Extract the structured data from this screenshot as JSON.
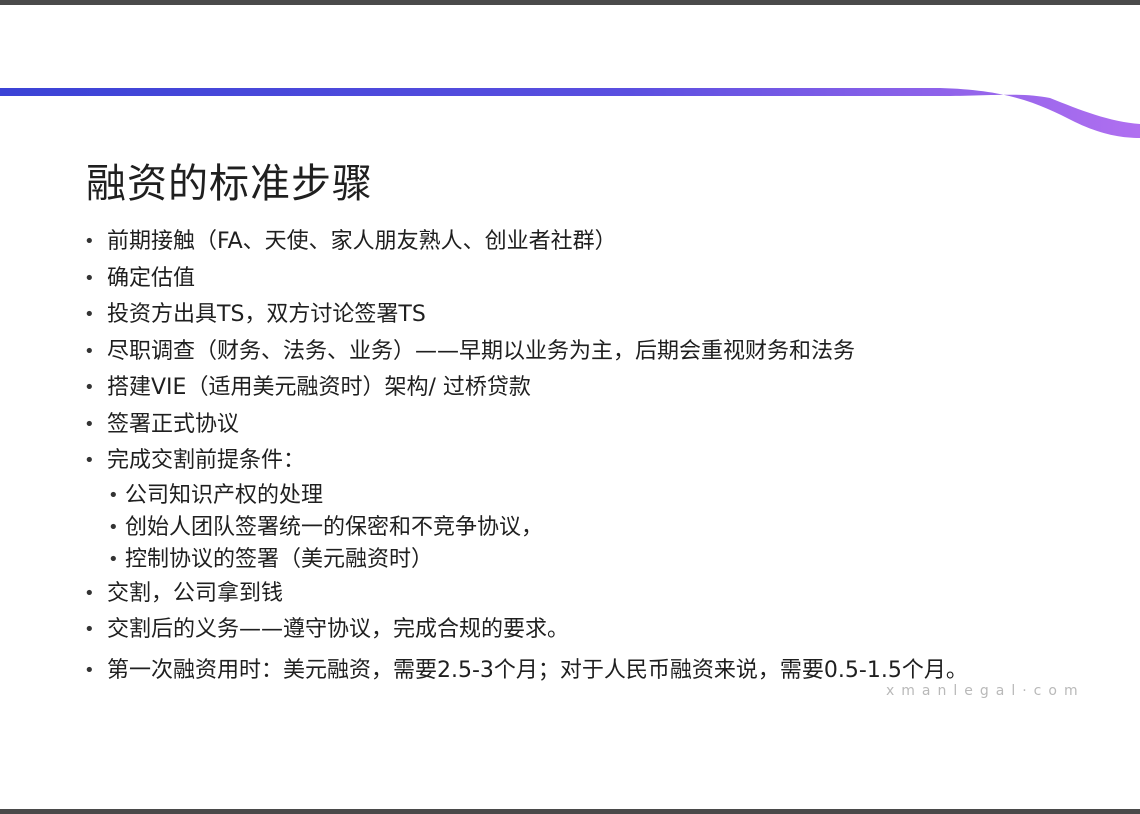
{
  "slide": {
    "title": "融资的标准步骤",
    "bullets": [
      "前期接触（FA、天使、家人朋友熟人、创业者社群）",
      "确定估值",
      "投资方出具TS，双方讨论签署TS",
      "尽职调查（财务、法务、业务）——早期以业务为主，后期会重视财务和法务",
      "搭建VIE（适用美元融资时）架构/ 过桥贷款",
      "签署正式协议",
      "完成交割前提条件："
    ],
    "sub_bullets": [
      "公司知识产权的处理",
      "创始人团队签署统一的保密和不竞争协议，",
      "控制协议的签署（美元融资时）"
    ],
    "bullets_after": [
      "交割，公司拿到钱",
      "交割后的义务——遵守协议，完成合规的要求。",
      "第一次融资用时：美元融资，需要2.5-3个月；对于人民币融资来说，需要0.5-1.5个月。"
    ],
    "watermark": "xmanlegal·com"
  },
  "colors": {
    "wave_left": "#3b43d6",
    "wave_right": "#b06ff0"
  }
}
